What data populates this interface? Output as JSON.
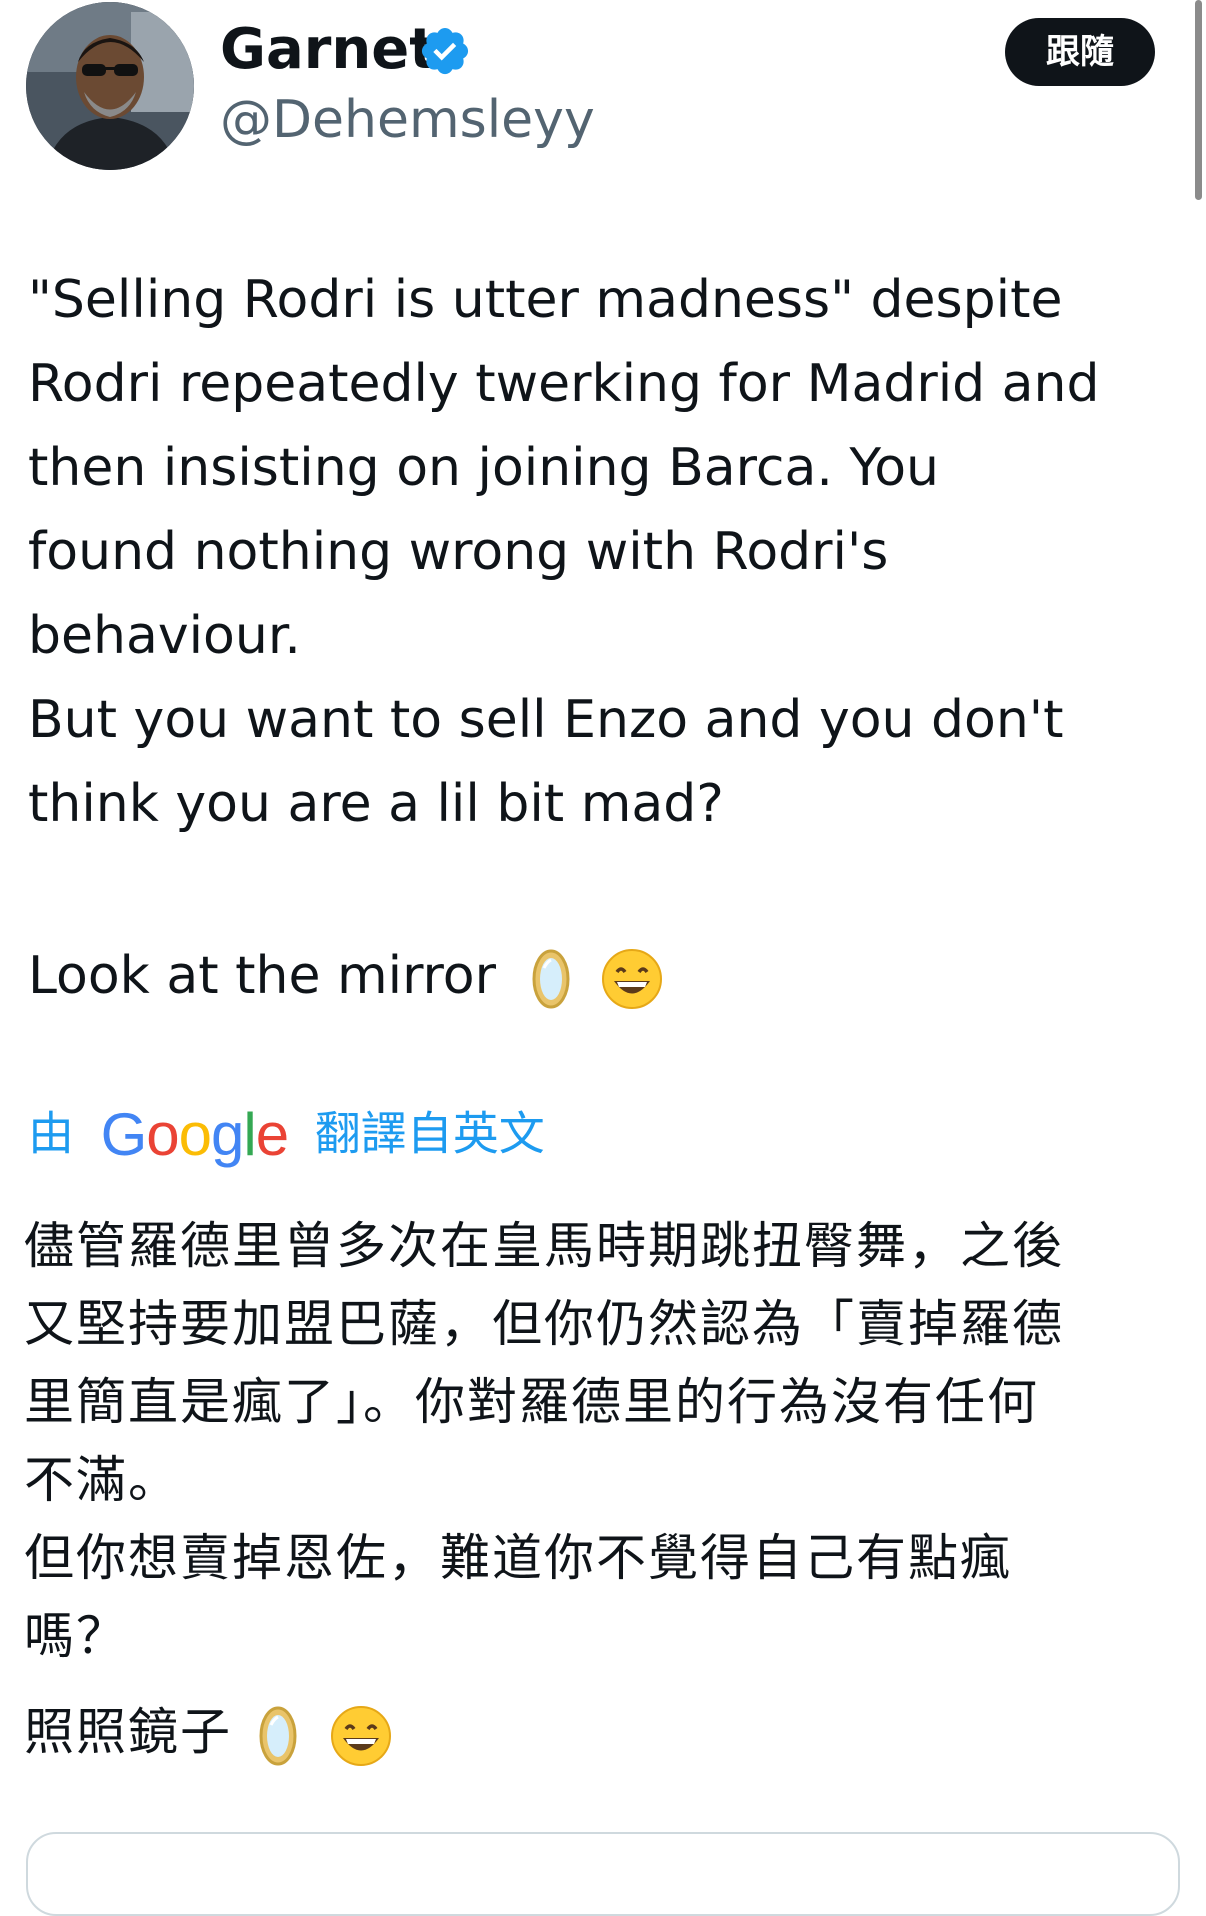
{
  "author": {
    "display_name": "Garnet",
    "handle": "@Dehemsleyy",
    "avatar_icon": "profile-photo",
    "verified_icon": "verified-badge-icon",
    "verified_color": "#1d9bf0"
  },
  "follow_button": {
    "label": "跟隨"
  },
  "tweet": {
    "lines": [
      "\"Selling Rodri is utter madness\" despite",
      "Rodri repeatedly twerking for Madrid and",
      "then insisting on joining Barca. You",
      "found nothing wrong with Rodri's",
      "behaviour.",
      "But you want to sell Enzo and you don't",
      "think you are a lil bit mad?"
    ],
    "mirror_text": "Look at the mirror"
  },
  "translation": {
    "prefix": "由",
    "provider_letters": [
      "G",
      "o",
      "o",
      "g",
      "l",
      "e"
    ],
    "suffix": "翻譯自英文",
    "lines": [
      "儘管羅德里曾多次在皇馬時期跳扭臀舞，之後",
      "又堅持要加盟巴薩，但你仍然認為「賣掉羅德",
      "里簡直是瘋了」。你對羅德里的行為沒有任何",
      "不滿。",
      "但你想賣掉恩佐，難道你不覺得自己有點瘋",
      "嗎？"
    ],
    "mirror_text": "照照鏡子"
  },
  "colors": {
    "link": "#1d9bf0",
    "text": "#0f1419",
    "secondary": "#536471",
    "button_bg": "#0f1419"
  },
  "emojis": [
    "mirror-emoji",
    "grinning-face-emoji"
  ]
}
